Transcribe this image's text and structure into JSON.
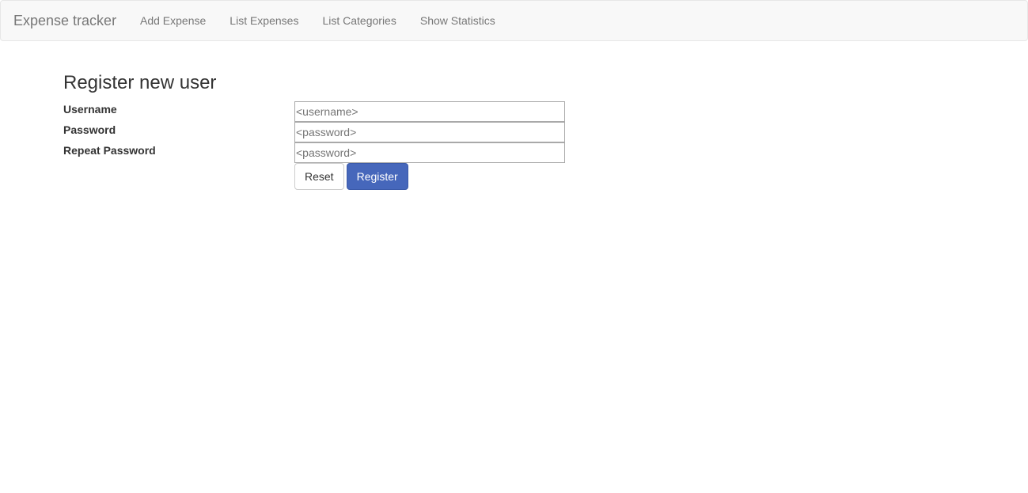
{
  "navbar": {
    "brand": "Expense tracker",
    "items": [
      {
        "label": "Add Expense"
      },
      {
        "label": "List Expenses"
      },
      {
        "label": "List Categories"
      },
      {
        "label": "Show Statistics"
      }
    ]
  },
  "form": {
    "title": "Register new user",
    "fields": [
      {
        "label": "Username",
        "placeholder": "<username>",
        "value": ""
      },
      {
        "label": "Password",
        "placeholder": "<password>",
        "value": ""
      },
      {
        "label": "Repeat Password",
        "placeholder": "<password>",
        "value": ""
      }
    ],
    "reset_label": "Reset",
    "register_label": "Register"
  },
  "colors": {
    "navbar_bg": "#f8f8f8",
    "primary_button": "#4667bb"
  }
}
